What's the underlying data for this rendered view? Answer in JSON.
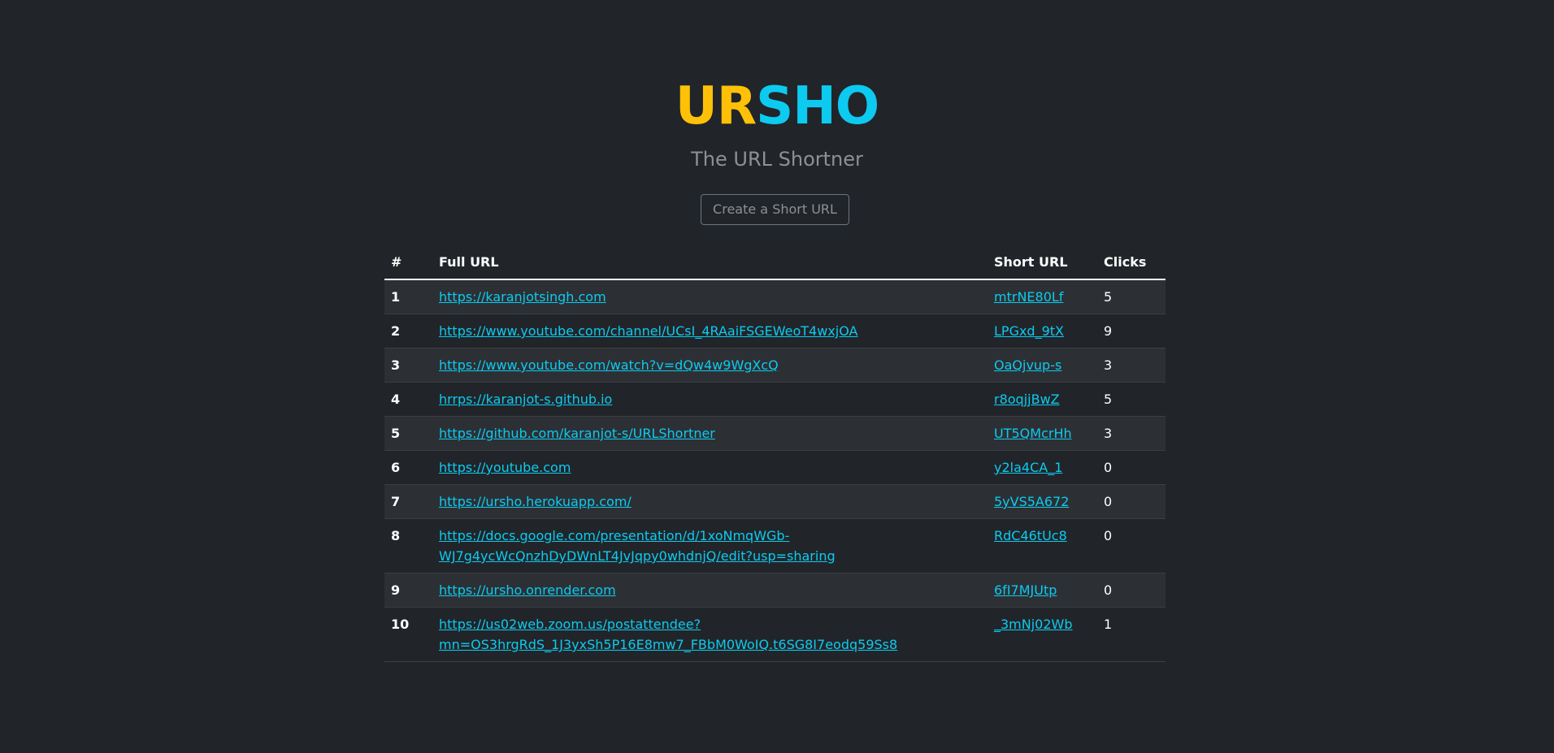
{
  "app": {
    "logo_part1": "UR",
    "logo_part2": "SHO",
    "subtitle": "The URL Shortner",
    "create_button": "Create a Short URL"
  },
  "colors": {
    "background": "#212529",
    "logo_yellow": "#ffc107",
    "logo_cyan": "#0dcaf0",
    "link": "#0dcaf0"
  },
  "table": {
    "headers": [
      "#",
      "Full URL",
      "Short URL",
      "Clicks"
    ],
    "rows": [
      {
        "num": "1",
        "full": "https://karanjotsingh.com",
        "short": "mtrNE80Lf",
        "clicks": "5"
      },
      {
        "num": "2",
        "full": "https://www.youtube.com/channel/UCsI_4RAaiFSGEWeoT4wxjOA",
        "short": "LPGxd_9tX",
        "clicks": "9"
      },
      {
        "num": "3",
        "full": "https://www.youtube.com/watch?v=dQw4w9WgXcQ",
        "short": "OaQjvup-s",
        "clicks": "3"
      },
      {
        "num": "4",
        "full": "hrrps://karanjot-s.github.io",
        "short": "r8oqjjBwZ",
        "clicks": "5"
      },
      {
        "num": "5",
        "full": "https://github.com/karanjot-s/URLShortner",
        "short": "UT5QMcrHh",
        "clicks": "3"
      },
      {
        "num": "6",
        "full": "https://youtube.com",
        "short": "y2la4CA_1",
        "clicks": "0"
      },
      {
        "num": "7",
        "full": "https://ursho.herokuapp.com/",
        "short": "5yVS5A672",
        "clicks": "0"
      },
      {
        "num": "8",
        "full": "https://docs.google.com/presentation/d/1xoNmqWGb-WJ7g4ycWcQnzhDyDWnLT4JvJqpy0whdnjQ/edit?usp=sharing",
        "full_line1": "https://docs.google.com/presentation/d/1xoNmqWGb-",
        "full_line2": "WJ7g4ycWcQnzhDyDWnLT4JvJqpy0whdnjQ/edit?usp=sharing",
        "short": "RdC46tUc8",
        "clicks": "0"
      },
      {
        "num": "9",
        "full": "https://ursho.onrender.com",
        "short": "6fI7MJUtp",
        "clicks": "0"
      },
      {
        "num": "10",
        "full": "https://us02web.zoom.us/postattendee?mn=OS3hrgRdS_1J3yxSh5P16E8mw7_FBbM0WoIQ.t6SG8I7eodq59Ss8",
        "full_line1": "https://us02web.zoom.us/postattendee?",
        "full_line2": "mn=OS3hrgRdS_1J3yxSh5P16E8mw7_FBbM0WoIQ.t6SG8I7eodq59Ss8",
        "short": "_3mNj02Wb",
        "clicks": "1"
      }
    ]
  }
}
